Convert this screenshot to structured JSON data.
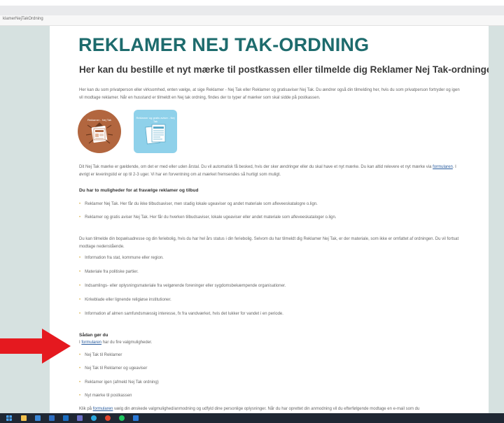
{
  "browser": {
    "tab_text": "klamerNejTakOrdning"
  },
  "page": {
    "title": "REKLAMER NEJ TAK-ORDNING",
    "subtitle": "Her kan du bestille et nyt mærke til postkassen eller tilmelde dig Reklamer Nej Tak-ordningen",
    "intro": "Her kan du som privatperson eller virksomhed, enten vælge, at sige Reklamer - Nej Tak eller Reklamer og gratisaviser Nej Tak. Du ændrer også din tilmelding her, hvis du som privatperson fortryder og igen vil modtage reklamer. Når en husstand er tilmeldt en Nej tak ordning, findes der to typer af mærker som skal sidde på postkassen.",
    "stamp_circle_label": "Reklamer - Nej Tak",
    "stamp_square_label": "Reklamer og gratis aviser - Nej Tak",
    "validity_text_before": "Dit Nej Tak mærke er gældende, om det er med eller uden årstal. Du vil automatisk få besked, hvis der sker ændringer eller du skal have et nyt mærke. Du kan altid relevere et nyt mærke via ",
    "validity_link": "formularen",
    "validity_text_after": ". I øvrigt er leveringstid er op til 2-3 uger. Vi har en forventning om at mærket fremsendes så hurtigt som muligt.",
    "options_heading": "Du har to muligheder for at fravælge reklamer og tilbud",
    "options": [
      "Reklamer Nej Tak. Her får du ikke tilbudsaviser, men stadig lokale ugeaviser og andet materiale som afleveeskatalogre o.lign.",
      "Reklamer og gratis aviser Nej Tak. Her får du hverken tilbudsaviser, lokale ugeaviser eller andet materiale som afleveeskataloger o.lign."
    ],
    "address_paragraph": "Du kan tilmelde din bopælsadresse og din feriebolig, hvis du har hel års status i din feriebolig. Selvom du har tilmeldt dig Reklamer Nej Tak, er der materiale, som ikke er omfattet af ordningen. Du vil fortsat modtage nedenstående.",
    "exceptions": [
      "Information fra stat, kommune eller region.",
      "Materiale fra politiske partier.",
      "Indsamlings- eller oplysningsmateriale fra velgørende foreninger eller sygdomsbekæmpende organisationer.",
      "Kirkeblade eller lignende religiøse institutioner.",
      "Information af almen samfundsmæssig interesse, fx fra vandværket, hvis det lukker for vandet i en periode."
    ],
    "howto_heading": "Sådan gør du",
    "howto_intro_before": "I ",
    "howto_intro_link": "formularen",
    "howto_intro_after": " har du fire valgmuligheder.",
    "choices": [
      "Nej Tak til Reklamer",
      "Nej Tak til Reklamer og ugeaviser",
      "Reklamer igen (afmeld Nej Tak ordning)",
      "Nyt mærke til postkassen"
    ],
    "final_before": "Klik på ",
    "final_link": "formularen",
    "final_after": " vælg din ønskede valgmulighed/anmodning og udfyld dine personlige oplysninger. Når du har oprettet din anmodning vil du efterfølgende modtage en e-mail som du"
  },
  "colors": {
    "title": "#1d6b6d",
    "circle_stamp": "#b2663f",
    "square_stamp": "#8fd1ea",
    "arrow": "#e5191f",
    "bullet": "#d8b24a",
    "link": "#2a5d9f"
  },
  "taskbar": {
    "icons": [
      "windows-start-icon",
      "file-explorer-icon",
      "store-icon",
      "mail-icon",
      "outlook-icon",
      "teams-icon",
      "edge-icon",
      "chrome-icon",
      "spotify-icon",
      "app-icon"
    ]
  }
}
